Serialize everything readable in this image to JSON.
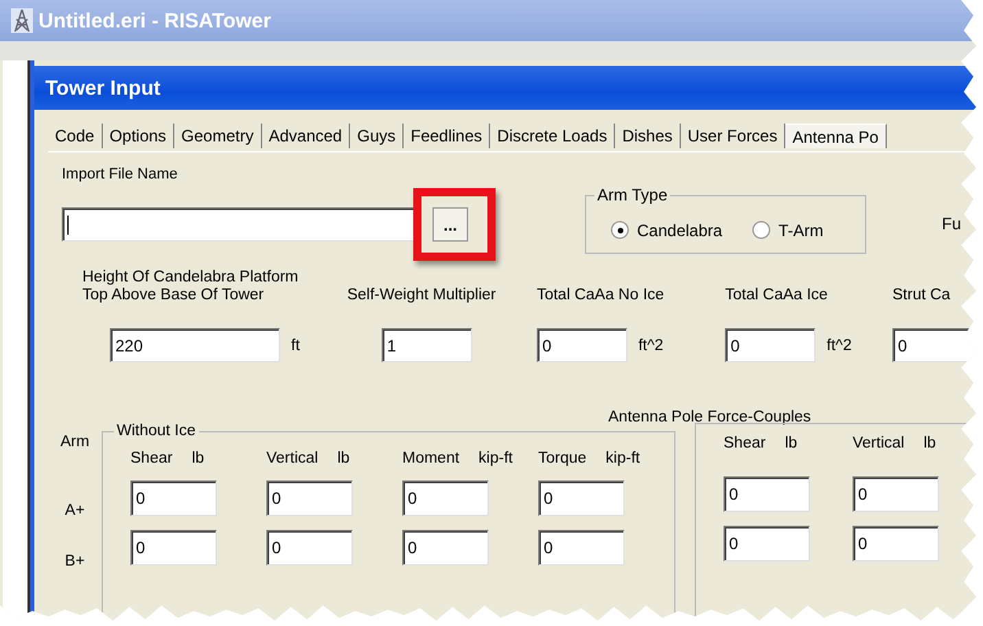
{
  "app_window": {
    "title": "Untitled.eri - RISATower"
  },
  "dialog": {
    "title": "Tower Input"
  },
  "tabs": [
    {
      "label": "Code",
      "selected": false
    },
    {
      "label": "Options",
      "selected": false
    },
    {
      "label": "Geometry",
      "selected": false
    },
    {
      "label": "Advanced",
      "selected": false
    },
    {
      "label": "Guys",
      "selected": false
    },
    {
      "label": "Feedlines",
      "selected": false
    },
    {
      "label": "Discrete Loads",
      "selected": false
    },
    {
      "label": "Dishes",
      "selected": false
    },
    {
      "label": "User Forces",
      "selected": false
    },
    {
      "label": "Antenna Po",
      "selected": true
    }
  ],
  "import_file": {
    "label": "Import File Name",
    "browse_button": "...",
    "highlighted": true
  },
  "arm_type": {
    "label": "Arm Type",
    "options": [
      {
        "label": "Candelabra",
        "selected": true
      },
      {
        "label": "T-Arm",
        "selected": false
      }
    ]
  },
  "side_label": "Fu",
  "properties": [
    {
      "label_lines": [
        "Height Of Candelabra Platform",
        "Top Above Base Of Tower"
      ],
      "value": "220",
      "unit": "ft"
    },
    {
      "label_lines": [
        "Self-Weight Multiplier"
      ],
      "value": "1"
    },
    {
      "label_lines": [
        "Total CaAa No Ice"
      ],
      "value": "0",
      "unit": "ft^2"
    },
    {
      "label_lines": [
        "Total CaAa Ice"
      ],
      "value": "0",
      "unit": "ft^2"
    },
    {
      "label_lines": [
        "Strut Ca"
      ],
      "value": "0"
    }
  ],
  "force_couples": {
    "title": "Antenna Pole Force-Couples",
    "arm_header": "Arm",
    "groups": [
      {
        "title": "Without Ice",
        "columns": [
          {
            "name": "Shear",
            "unit": "lb"
          },
          {
            "name": "Vertical",
            "unit": "lb"
          },
          {
            "name": "Moment",
            "unit": "kip-ft"
          },
          {
            "name": "Torque",
            "unit": "kip-ft"
          }
        ]
      },
      {
        "columns": [
          {
            "name": "Shear",
            "unit": "lb"
          },
          {
            "name": "Vertical",
            "unit": "lb"
          }
        ]
      }
    ],
    "rows": [
      {
        "arm": "A+",
        "values": [
          [
            "0",
            "0",
            "0",
            "0"
          ],
          [
            "0",
            "0"
          ]
        ]
      },
      {
        "arm": "B+",
        "values": [
          [
            "0",
            "0",
            "0",
            "0"
          ],
          [
            "0",
            "0"
          ]
        ]
      }
    ]
  }
}
